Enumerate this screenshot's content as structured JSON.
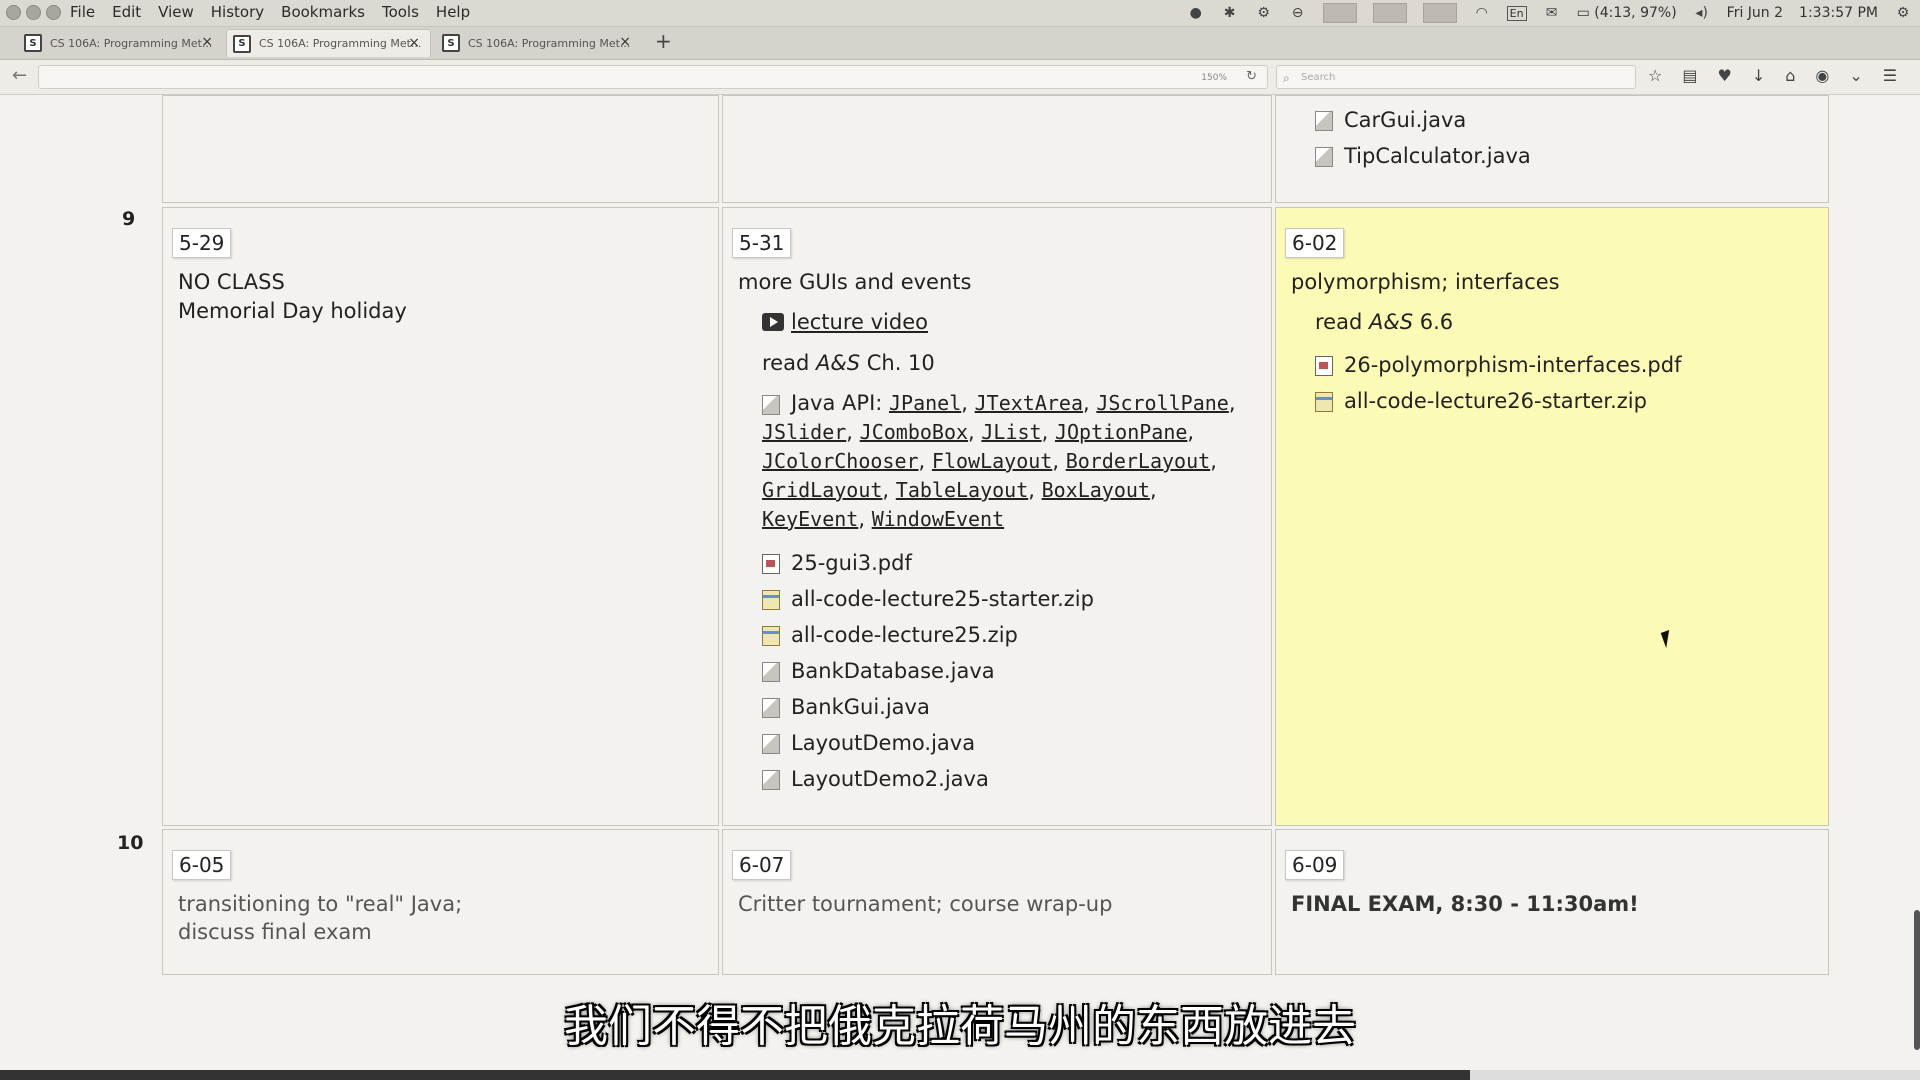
{
  "menubar": {
    "items": [
      "File",
      "Edit",
      "View",
      "History",
      "Bookmarks",
      "Tools",
      "Help"
    ],
    "status": "(4:13, 97%)",
    "lang": "En",
    "date": "Fri Jun 2",
    "time": "1:33:57 PM"
  },
  "tabs": [
    {
      "title": "CS 106A: Programming Met..."
    },
    {
      "title": "CS 106A: Programming Met..."
    },
    {
      "title": "CS 106A: Programming Met..."
    }
  ],
  "toolbar": {
    "zoom": "150%",
    "search_placeholder": "Search"
  },
  "prev_week": {
    "files": [
      "CarGui.java",
      "TipCalculator.java"
    ]
  },
  "week9": {
    "number": "9",
    "mon": {
      "date": "5-29",
      "line1": "NO CLASS",
      "line2": "Memorial Day holiday"
    },
    "wed": {
      "date": "5-31",
      "title": "more GUIs and events",
      "video": "lecture video",
      "read_pre": "read ",
      "read_em": "A&S",
      "read_post": " Ch. 10",
      "api_label": "Java API: ",
      "api": [
        "JPanel",
        "JTextArea",
        "JScrollPane",
        "JSlider",
        "JComboBox",
        "JList",
        "JOptionPane",
        "JColorChooser",
        "FlowLayout",
        "BorderLayout",
        "GridLayout",
        "TableLayout",
        "BoxLayout",
        "KeyEvent",
        "WindowEvent"
      ],
      "files": [
        "25-gui3.pdf",
        "all-code-lecture25-starter.zip",
        "all-code-lecture25.zip",
        "BankDatabase.java",
        "BankGui.java",
        "LayoutDemo.java",
        "LayoutDemo2.java"
      ]
    },
    "fri": {
      "date": "6-02",
      "title": "polymorphism; interfaces",
      "read_pre": "read ",
      "read_em": "A&S",
      "read_post": " 6.6",
      "files": [
        "26-polymorphism-interfaces.pdf",
        "all-code-lecture26-starter.zip"
      ]
    }
  },
  "week10": {
    "number": "10",
    "mon": {
      "date": "6-05",
      "line1": "transitioning to \"real\" Java;",
      "line2": "discuss final exam"
    },
    "wed": {
      "date": "6-07",
      "line1": "Critter tournament; course wrap-up"
    },
    "fri": {
      "date": "6-09",
      "line1": "FINAL EXAM, 8:30 - 11:30am!"
    }
  },
  "subtitle": "我们不得不把俄克拉荷马州的东西放进去",
  "colors": {
    "highlight": "#fcfbb5",
    "page_bg": "#f4f2ee",
    "border": "#c9c5bf"
  }
}
